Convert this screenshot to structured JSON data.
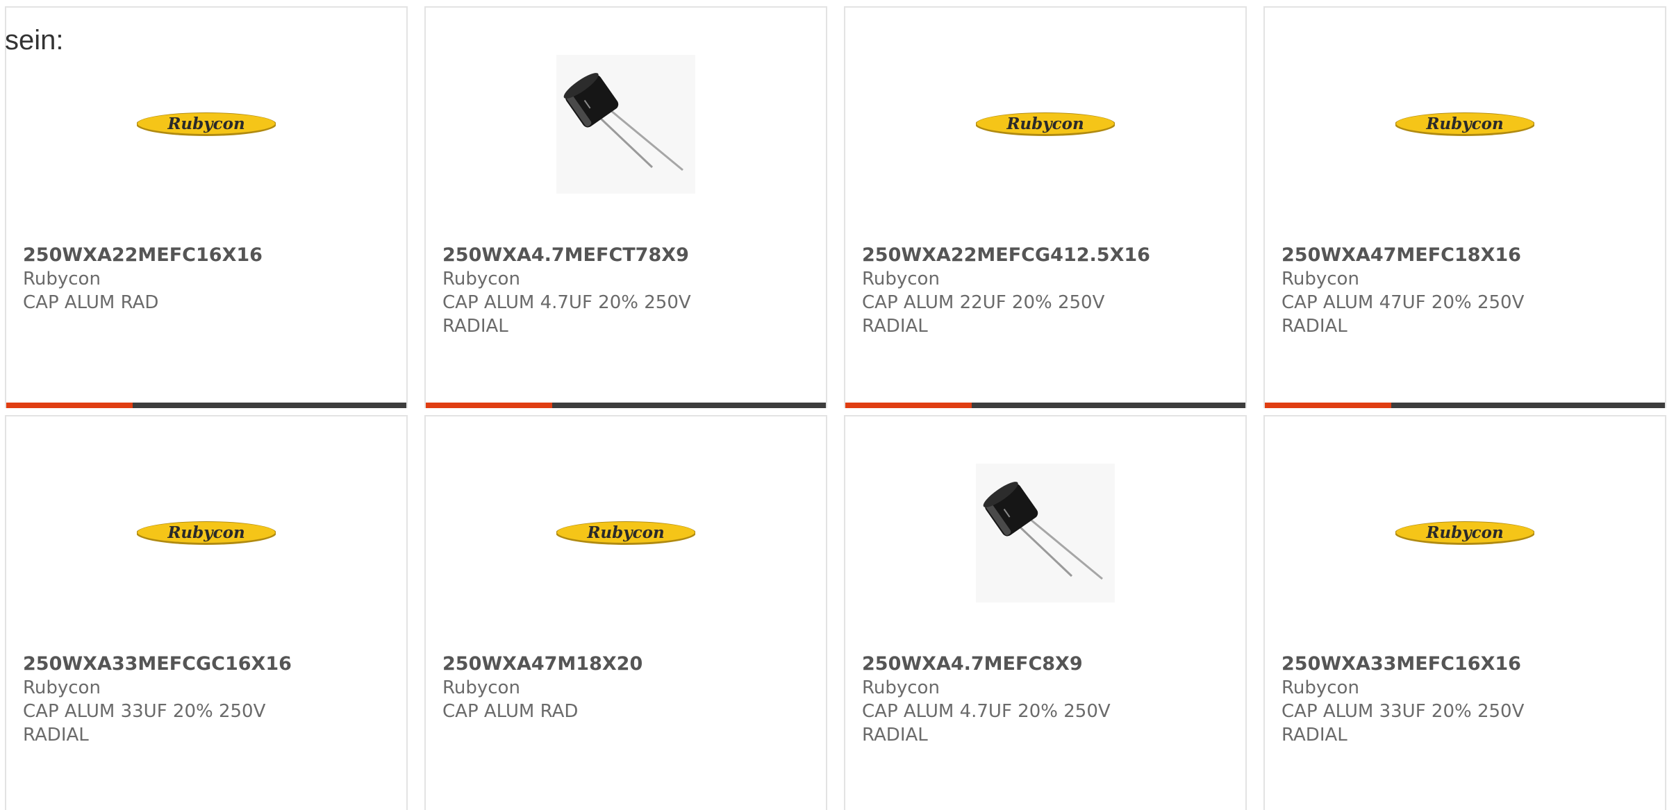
{
  "overlay_text": "sein:",
  "logo_text": "Rubycon",
  "colors": {
    "accent": "#e03e12",
    "bar": "#3d3d3d",
    "logo_fill": "#f5c518",
    "text": "#6a6a6a"
  },
  "products": [
    {
      "part_number": "250WXA22MEFC16X16",
      "manufacturer": "Rubycon",
      "description": "CAP ALUM RAD",
      "image": "rubycon-logo"
    },
    {
      "part_number": "250WXA4.7MEFCT78X9",
      "manufacturer": "Rubycon",
      "description": "CAP ALUM 4.7UF 20% 250V RADIAL",
      "image": "capacitor-photo"
    },
    {
      "part_number": "250WXA22MEFCG412.5X16",
      "manufacturer": "Rubycon",
      "description": "CAP ALUM 22UF 20% 250V RADIAL",
      "image": "rubycon-logo"
    },
    {
      "part_number": "250WXA47MEFC18X16",
      "manufacturer": "Rubycon",
      "description": "CAP ALUM 47UF 20% 250V RADIAL",
      "image": "rubycon-logo"
    },
    {
      "part_number": "250WXA33MEFCGC16X16",
      "manufacturer": "Rubycon",
      "description": "CAP ALUM 33UF 20% 250V RADIAL",
      "image": "rubycon-logo"
    },
    {
      "part_number": "250WXA47M18X20",
      "manufacturer": "Rubycon",
      "description": "CAP ALUM RAD",
      "image": "rubycon-logo"
    },
    {
      "part_number": "250WXA4.7MEFC8X9",
      "manufacturer": "Rubycon",
      "description": "CAP ALUM 4.7UF 20% 250V RADIAL",
      "image": "capacitor-photo"
    },
    {
      "part_number": "250WXA33MEFC16X16",
      "manufacturer": "Rubycon",
      "description": "CAP ALUM 33UF 20% 250V RADIAL",
      "image": "rubycon-logo"
    }
  ]
}
